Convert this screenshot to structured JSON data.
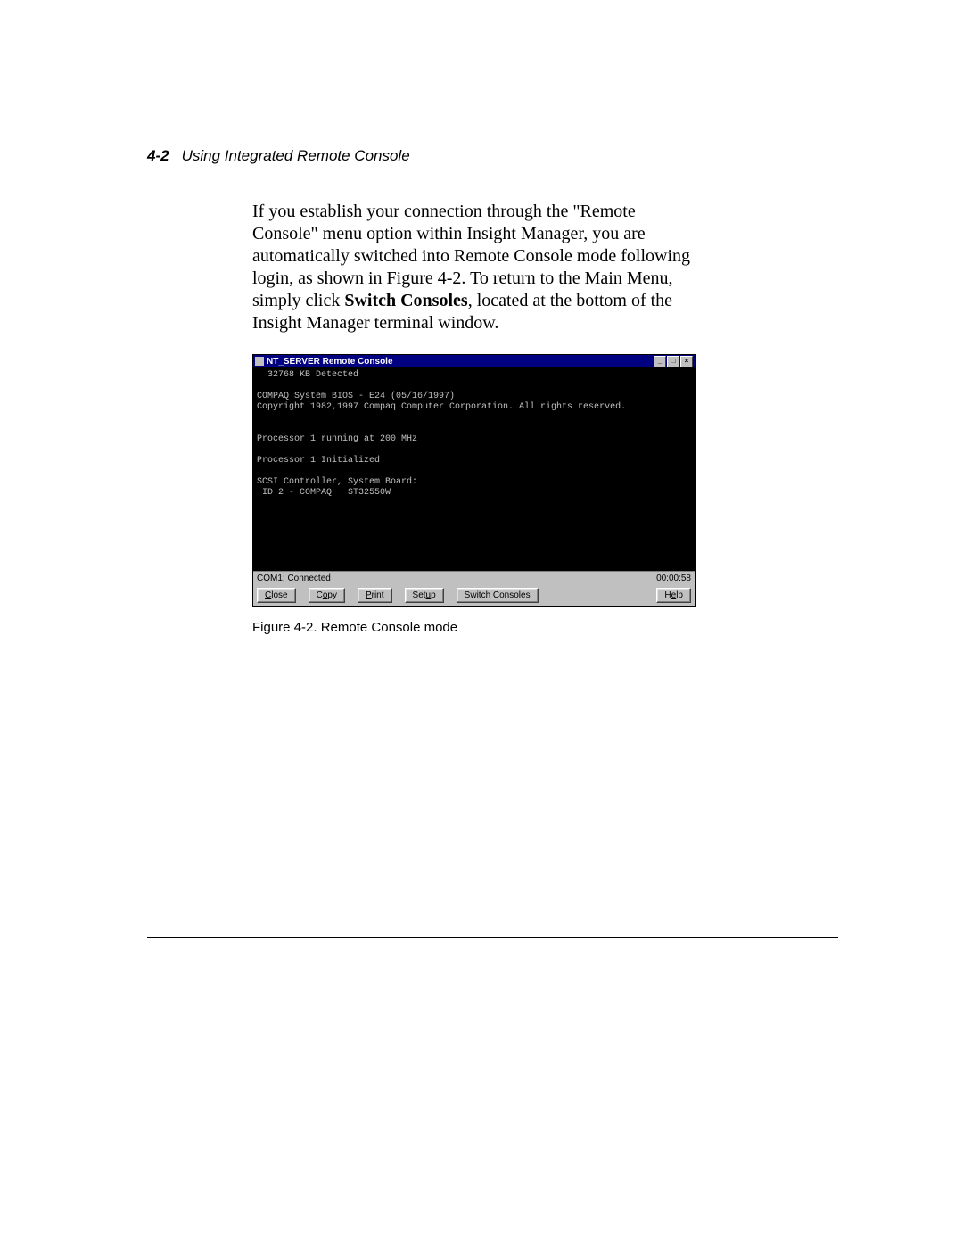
{
  "header": {
    "page_number": "4-2",
    "title": "Using Integrated Remote Console"
  },
  "body": {
    "p1_a": "If you establish your connection through the \"Remote Console\" menu option within Insight Manager, you are automatically switched into Remote Console mode following login, as shown in Figure 4-2. To return to the Main Menu, simply click ",
    "p1_bold": "Switch Consoles",
    "p1_b": ", located at the bottom of the Insight Manager terminal window."
  },
  "figure": {
    "caption": "Figure 4-2.    Remote Console mode",
    "window_title": "NT_SERVER Remote Console",
    "win_btn_min": "_",
    "win_btn_max": "□",
    "win_btn_close": "×",
    "terminal_lines": [
      "  32768 KB Detected",
      "",
      "COMPAQ System BIOS - E24 (05/16/1997)",
      "Copyright 1982,1997 Compaq Computer Corporation. All rights reserved.",
      "",
      "",
      "Processor 1 running at 200 MHz",
      "",
      "Processor 1 Initialized",
      "",
      "SCSI Controller, System Board:",
      " ID 2 - COMPAQ   ST32550W"
    ],
    "status_left": "COM1:  Connected",
    "status_right": "00:00:58",
    "buttons": {
      "close_u": "C",
      "close_r": "lose",
      "copy_pre": "C",
      "copy_u": "o",
      "copy_r": "py",
      "print_u": "P",
      "print_r": "rint",
      "setup_pre": "Set",
      "setup_u": "u",
      "setup_r": "p",
      "switch": "Switch Consoles",
      "help_pre": "H",
      "help_u": "e",
      "help_r": "lp"
    }
  }
}
